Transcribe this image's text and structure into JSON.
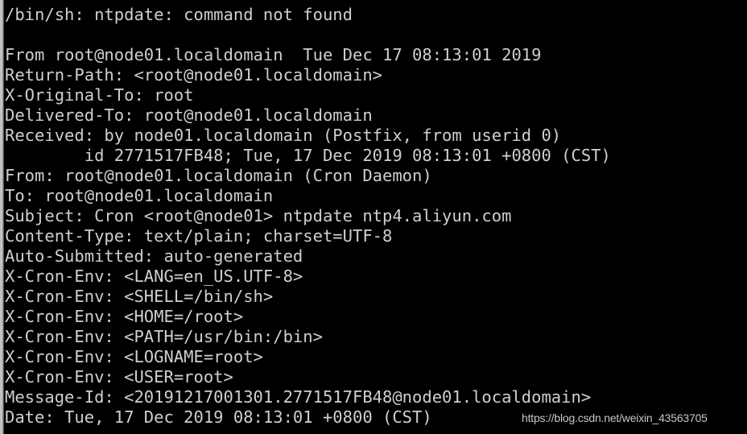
{
  "terminal": {
    "background_color": "#000000",
    "text_color": "#cfcfcf",
    "gutter_color": "#c0c0c0",
    "lines": [
      {
        "id": "error-line",
        "text": "/bin/sh: ntpdate: command not found"
      },
      {
        "id": "blank-1",
        "text": ""
      },
      {
        "id": "mbox-from-line",
        "text": "From root@node01.localdomain  Tue Dec 17 08:13:01 2019"
      },
      {
        "id": "return-path-header",
        "text": "Return-Path: <root@node01.localdomain>"
      },
      {
        "id": "x-original-to-header",
        "text": "X-Original-To: root"
      },
      {
        "id": "delivered-to-header",
        "text": "Delivered-To: root@node01.localdomain"
      },
      {
        "id": "received-header",
        "text": "Received: by node01.localdomain (Postfix, from userid 0)"
      },
      {
        "id": "received-header-continuation",
        "text": "        id 2771517FB48; Tue, 17 Dec 2019 08:13:01 +0800 (CST)"
      },
      {
        "id": "from-header",
        "text": "From: root@node01.localdomain (Cron Daemon)"
      },
      {
        "id": "to-header",
        "text": "To: root@node01.localdomain"
      },
      {
        "id": "subject-header",
        "text": "Subject: Cron <root@node01> ntpdate ntp4.aliyun.com"
      },
      {
        "id": "content-type-header",
        "text": "Content-Type: text/plain; charset=UTF-8"
      },
      {
        "id": "auto-submitted-header",
        "text": "Auto-Submitted: auto-generated"
      },
      {
        "id": "x-cron-env-lang",
        "text": "X-Cron-Env: <LANG=en_US.UTF-8>"
      },
      {
        "id": "x-cron-env-shell",
        "text": "X-Cron-Env: <SHELL=/bin/sh>"
      },
      {
        "id": "x-cron-env-home",
        "text": "X-Cron-Env: <HOME=/root>"
      },
      {
        "id": "x-cron-env-path",
        "text": "X-Cron-Env: <PATH=/usr/bin:/bin>"
      },
      {
        "id": "x-cron-env-logname",
        "text": "X-Cron-Env: <LOGNAME=root>"
      },
      {
        "id": "x-cron-env-user",
        "text": "X-Cron-Env: <USER=root>"
      },
      {
        "id": "message-id-header",
        "text": "Message-Id: <20191217001301.2771517FB48@node01.localdomain>"
      },
      {
        "id": "date-header",
        "text": "Date: Tue, 17 Dec 2019 08:13:01 +0800 (CST)"
      }
    ]
  },
  "watermark": {
    "text": "https://blog.csdn.net/weixin_43563705"
  }
}
